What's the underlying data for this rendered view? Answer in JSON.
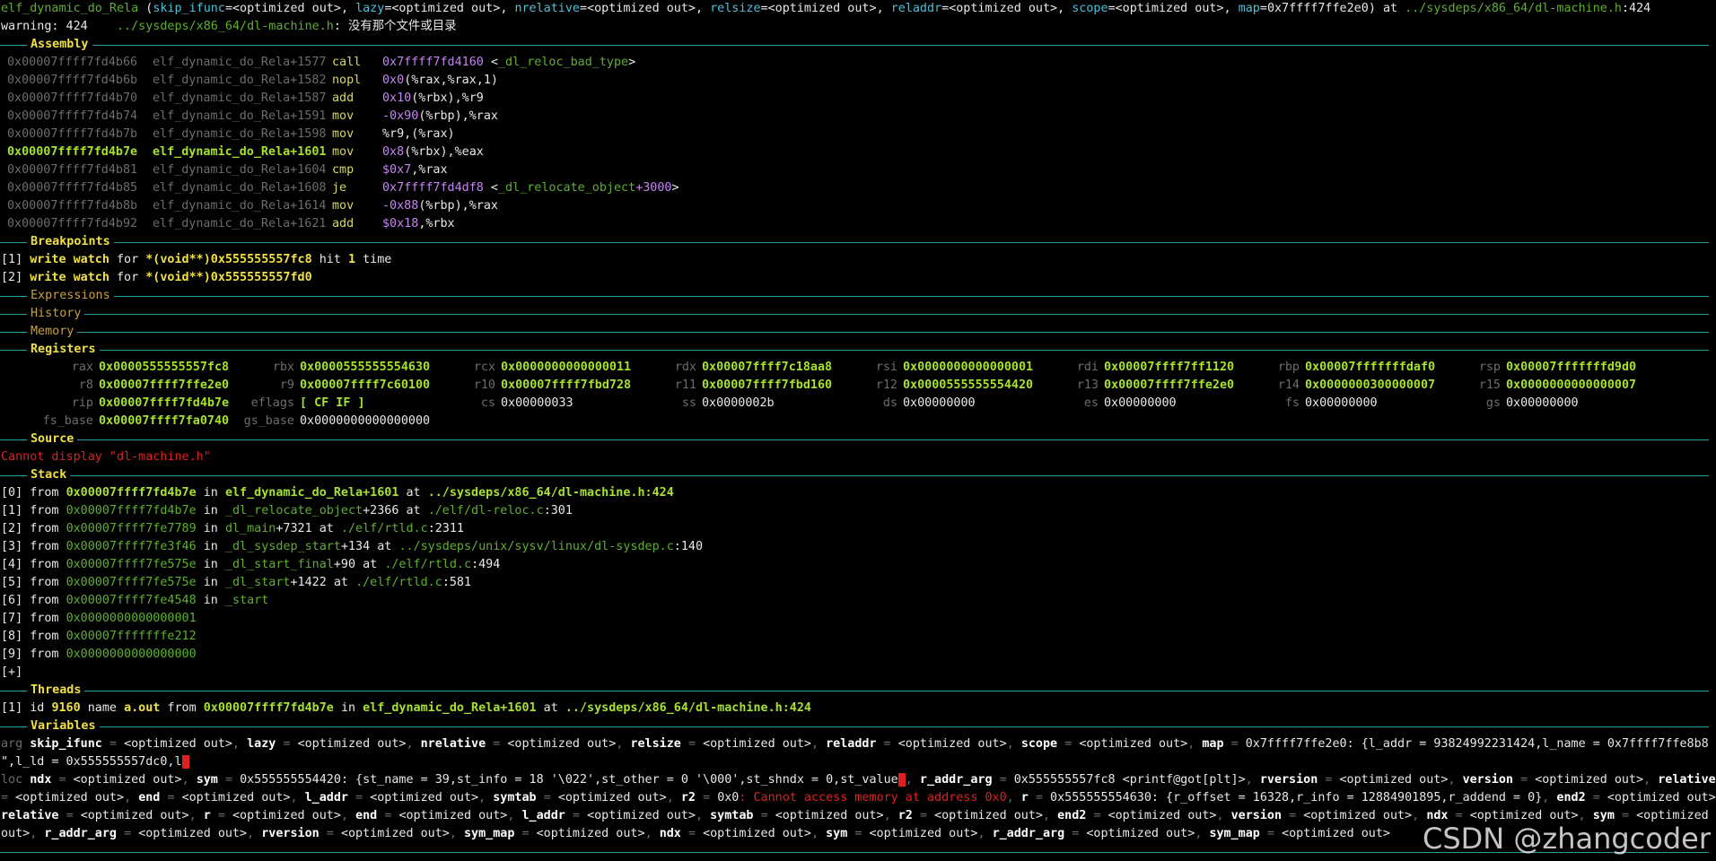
{
  "frame": {
    "func": "elf_dynamic_do_Rela",
    "args": [
      {
        "name": "skip_ifunc",
        "value": "<optimized out>"
      },
      {
        "name": "lazy",
        "value": "<optimized out>"
      },
      {
        "name": "nrelative",
        "value": "<optimized out>"
      },
      {
        "name": "relsize",
        "value": "<optimized out>"
      },
      {
        "name": "reladdr",
        "value": "<optimized out>"
      },
      {
        "name": "scope",
        "value": "<optimized out>"
      },
      {
        "name": "map",
        "value": "0x7ffff7ffe2e0"
      }
    ],
    "at": "at",
    "file": "../sysdeps/x86_64/dl-machine.h",
    "line": ":424",
    "warning_prefix": "warning: 424",
    "warning_file": "../sysdeps/x86_64/dl-machine.h",
    "warning_msg": ": 没有那个文件或目录"
  },
  "sections": {
    "assembly": "Assembly",
    "breakpoints": "Breakpoints",
    "expressions": "Expressions",
    "history": "History",
    "memory": "Memory",
    "registers": "Registers",
    "source": "Source",
    "stack": "Stack",
    "threads": "Threads",
    "variables": "Variables"
  },
  "assembly": [
    {
      "addr": "0x00007ffff7fd4b66",
      "sym": "elf_dynamic_do_Rela+1577",
      "mn": "call",
      "ops": "0x7ffff7fd4160 <_dl_reloc_bad_type>"
    },
    {
      "addr": "0x00007ffff7fd4b6b",
      "sym": "elf_dynamic_do_Rela+1582",
      "mn": "nopl",
      "ops": "0x0(%rax,%rax,1)"
    },
    {
      "addr": "0x00007ffff7fd4b70",
      "sym": "elf_dynamic_do_Rela+1587",
      "mn": "add",
      "ops": "0x10(%rbx),%r9"
    },
    {
      "addr": "0x00007ffff7fd4b74",
      "sym": "elf_dynamic_do_Rela+1591",
      "mn": "mov",
      "ops": "-0x90(%rbp),%rax"
    },
    {
      "addr": "0x00007ffff7fd4b7b",
      "sym": "elf_dynamic_do_Rela+1598",
      "mn": "mov",
      "ops": "%r9,(%rax)"
    },
    {
      "addr": "0x00007ffff7fd4b7e",
      "sym": "elf_dynamic_do_Rela+1601",
      "mn": "mov",
      "ops": "0x8(%rbx),%eax"
    },
    {
      "addr": "0x00007ffff7fd4b81",
      "sym": "elf_dynamic_do_Rela+1604",
      "mn": "cmp",
      "ops": "$0x7,%rax"
    },
    {
      "addr": "0x00007ffff7fd4b85",
      "sym": "elf_dynamic_do_Rela+1608",
      "mn": "je",
      "ops": "0x7ffff7fd4df8 <_dl_relocate_object+3000>"
    },
    {
      "addr": "0x00007ffff7fd4b8b",
      "sym": "elf_dynamic_do_Rela+1614",
      "mn": "mov",
      "ops": "-0x88(%rbp),%rax"
    },
    {
      "addr": "0x00007ffff7fd4b92",
      "sym": "elf_dynamic_do_Rela+1621",
      "mn": "add",
      "ops": "$0x18,%rbx"
    }
  ],
  "breakpoints": [
    {
      "num": "[1]",
      "kind": "write watch",
      "for": "for",
      "expr": "*(void**)0x555555557fc8",
      "hit": "hit",
      "count": "1",
      "time": "time"
    },
    {
      "num": "[2]",
      "kind": "write watch",
      "for": "for",
      "expr": "*(void**)0x555555557fd0"
    }
  ],
  "registers": [
    [
      {
        "n": "rax",
        "v": "0x0000555555557fc8",
        "c": true
      },
      {
        "n": "rbx",
        "v": "0x0000555555554630",
        "c": true
      },
      {
        "n": "rcx",
        "v": "0x0000000000000011",
        "c": true
      },
      {
        "n": "rdx",
        "v": "0x00007ffff7c18aa8",
        "c": true
      },
      {
        "n": "rsi",
        "v": "0x0000000000000001",
        "c": true
      },
      {
        "n": "rdi",
        "v": "0x00007ffff7ff1120",
        "c": true
      },
      {
        "n": "rbp",
        "v": "0x00007fffffffdaf0",
        "c": true
      },
      {
        "n": "rsp",
        "v": "0x00007fffffffd9d0",
        "c": true
      }
    ],
    [
      {
        "n": "r8",
        "v": "0x00007ffff7ffe2e0",
        "c": true
      },
      {
        "n": "r9",
        "v": "0x00007ffff7c60100",
        "c": true
      },
      {
        "n": "r10",
        "v": "0x00007ffff7fbd728",
        "c": true
      },
      {
        "n": "r11",
        "v": "0x00007ffff7fbd160",
        "c": true
      },
      {
        "n": "r12",
        "v": "0x0000555555554420",
        "c": true
      },
      {
        "n": "r13",
        "v": "0x00007ffff7ffe2e0",
        "c": true
      },
      {
        "n": "r14",
        "v": "0x0000000300000007",
        "c": true
      },
      {
        "n": "r15",
        "v": "0x0000000000000007",
        "c": true
      }
    ],
    [
      {
        "n": "rip",
        "v": "0x00007ffff7fd4b7e",
        "c": true
      },
      {
        "n": "eflags",
        "v": "[ CF IF ]",
        "c": true
      },
      {
        "n": "cs",
        "v": "0x00000033",
        "c": false
      },
      {
        "n": "ss",
        "v": "0x0000002b",
        "c": false
      },
      {
        "n": "ds",
        "v": "0x00000000",
        "c": false
      },
      {
        "n": "es",
        "v": "0x00000000",
        "c": false
      },
      {
        "n": "fs",
        "v": "0x00000000",
        "c": false
      },
      {
        "n": "gs",
        "v": "0x00000000",
        "c": false
      }
    ],
    [
      {
        "n": "fs_base",
        "v": "0x00007ffff7fa0740",
        "c": true
      },
      {
        "n": "gs_base",
        "v": "0x0000000000000000",
        "c": false
      }
    ]
  ],
  "source": {
    "error": "Cannot display \"dl-machine.h\""
  },
  "stack": [
    {
      "num": "[0]",
      "addr": "0x00007ffff7fd4b7e",
      "func": "elf_dynamic_do_Rela",
      "off": "+1601",
      "file": "../sysdeps/x86_64/dl-machine.h",
      "line": ":424",
      "cur": true
    },
    {
      "num": "[1]",
      "addr": "0x00007ffff7fd4b7e",
      "func": "_dl_relocate_object",
      "off": "+2366",
      "file": "./elf/dl-reloc.c",
      "line": ":301"
    },
    {
      "num": "[2]",
      "addr": "0x00007ffff7fe7789",
      "func": "dl_main",
      "off": "+7321",
      "file": "./elf/rtld.c",
      "line": ":2311"
    },
    {
      "num": "[3]",
      "addr": "0x00007ffff7fe3f46",
      "func": "_dl_sysdep_start",
      "off": "+134",
      "file": "../sysdeps/unix/sysv/linux/dl-sysdep.c",
      "line": ":140"
    },
    {
      "num": "[4]",
      "addr": "0x00007ffff7fe575e",
      "func": "_dl_start_final",
      "off": "+90",
      "file": "./elf/rtld.c",
      "line": ":494"
    },
    {
      "num": "[5]",
      "addr": "0x00007ffff7fe575e",
      "func": "_dl_start",
      "off": "+1422",
      "file": "./elf/rtld.c",
      "line": ":581"
    },
    {
      "num": "[6]",
      "addr": "0x00007ffff7fe4548",
      "func": "_start",
      "off": "",
      "file": "",
      "line": ""
    },
    {
      "num": "[7]",
      "addr": "0x0000000000000001",
      "func": "",
      "off": "",
      "file": "",
      "line": ""
    },
    {
      "num": "[8]",
      "addr": "0x00007fffffffe212",
      "func": "",
      "off": "",
      "file": "",
      "line": ""
    },
    {
      "num": "[9]",
      "addr": "0x0000000000000000",
      "func": "",
      "off": "",
      "file": "",
      "line": ""
    }
  ],
  "stack_more": "[+]",
  "threads": {
    "num": "[1]",
    "id_label": "id",
    "id": "9160",
    "name_label": "name",
    "name": "a.out",
    "from": "from",
    "addr": "0x00007ffff7fd4b7e",
    "in": "in",
    "func": "elf_dynamic_do_Rela+1601",
    "at": "at",
    "file": "../sysdeps/x86_64/dl-machine.h:424"
  },
  "variables": {
    "arg_label": "arg",
    "loc_label": "loc",
    "arg_line1": [
      [
        "skip_ifunc",
        "<optimized out>"
      ],
      [
        "lazy",
        "<optimized out>"
      ],
      [
        "nrelative",
        "<optimized out>"
      ],
      [
        "relsize",
        "<optimized out>"
      ],
      [
        "reladdr",
        "<optimized out>"
      ],
      [
        "scope",
        "<optimized out>"
      ]
    ],
    "map_name": "map",
    "map_addr": "0x7ffff7ffe2e0",
    "map_rest": ": {l_addr = 93824992231424,l_name = 0x7ffff7ffe8b8 \"",
    "arg_line2": "\",l_ld = 0x555555557dc0,l",
    "loc_ndx": [
      "ndx",
      "<optimized out>"
    ],
    "loc_sym": [
      "sym",
      "0x555555554420"
    ],
    "sym_rest": ": {st_name = 39,st_info = 18 '\\022',st_other = 0 '\\000',st_shndx = 0,st_value",
    "loc_line1_tail": [
      [
        "r_addr_arg",
        "0x555555557fc8 <printf@got[plt]>"
      ],
      [
        "rversion",
        "<optimized out>"
      ],
      [
        "version",
        "<optimized out>"
      ],
      [
        "relative",
        ""
      ]
    ],
    "loc_line2": [
      [
        "",
        "<optimized out>"
      ],
      [
        "end",
        "<optimized out>"
      ],
      [
        "l_addr",
        "<optimized out>"
      ],
      [
        "symtab",
        "<optimized out>"
      ]
    ],
    "r2_name": "r2",
    "r2_val": "0x0",
    "r2_err": ": Cannot access memory at address 0x0",
    "r_name": "r",
    "r_val": "0x555555554630",
    "r_rest": ": {r_offset = 16328,r_info = 12884901895,r_addend = 0}",
    "loc_line2_tail": [
      [
        "end2",
        "<optimized out>"
      ]
    ],
    "loc_line3": [
      [
        "relative",
        "<optimized out>"
      ],
      [
        "r",
        "<optimized out>"
      ],
      [
        "end",
        "<optimized out>"
      ],
      [
        "l_addr",
        "<optimized out>"
      ],
      [
        "symtab",
        "<optimized out>"
      ],
      [
        "r2",
        "<optimized out>"
      ],
      [
        "end2",
        "<optimized out>"
      ],
      [
        "version",
        "<optimized out>"
      ],
      [
        "ndx",
        "<optimized out>"
      ],
      [
        "sym",
        ""
      ]
    ],
    "loc_line4": [
      [
        "",
        "out>"
      ],
      [
        "r_addr_arg",
        "<optimized out>"
      ],
      [
        "rversion",
        "<optimized out>"
      ],
      [
        "sym_map",
        "<optimized out>"
      ],
      [
        "ndx",
        "<optimized out>"
      ],
      [
        "sym",
        "<optimized out>"
      ],
      [
        "r_addr_arg",
        "<optimized out>"
      ],
      [
        "sym_map",
        "<optimized out>"
      ]
    ],
    "line3_lead": "<optimized out>",
    "line4_lead_extra": "<optimized"
  },
  "watermark": "CSDN @zhangcoder"
}
